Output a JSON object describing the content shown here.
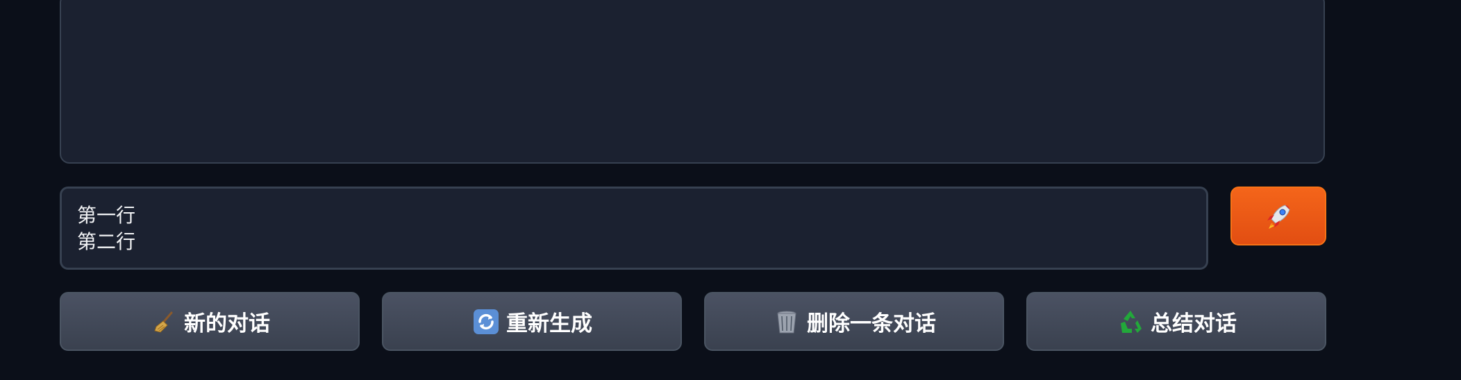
{
  "chat": {
    "messages": []
  },
  "input": {
    "value": "第一行\n第二行"
  },
  "send_button": {
    "icon": "rocket-icon"
  },
  "actions": [
    {
      "label": "新的对话",
      "icon": "broom-icon"
    },
    {
      "label": "重新生成",
      "icon": "refresh-icon"
    },
    {
      "label": "删除一条对话",
      "icon": "trash-icon"
    },
    {
      "label": "总结对话",
      "icon": "recycle-icon"
    }
  ],
  "colors": {
    "background": "#0b0f19",
    "panel": "#1b2130",
    "send_accent": "#f4651a",
    "button": "#434a5a"
  }
}
